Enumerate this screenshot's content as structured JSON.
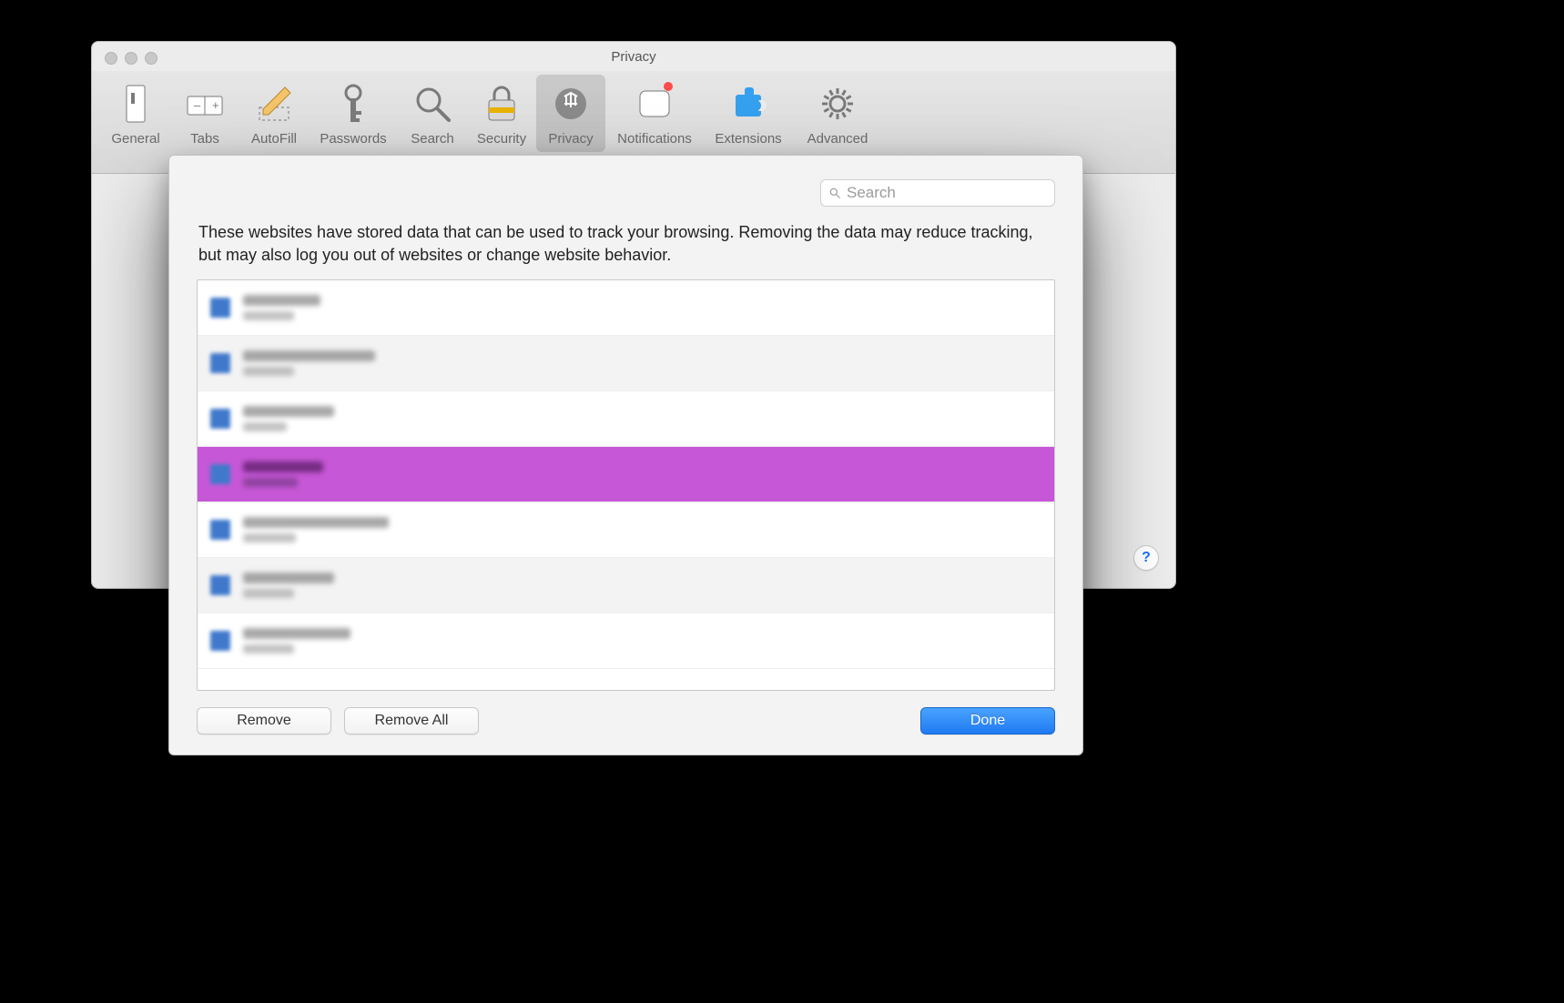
{
  "window": {
    "title": "Privacy"
  },
  "toolbar": {
    "items": [
      {
        "id": "general",
        "label": "General"
      },
      {
        "id": "tabs",
        "label": "Tabs"
      },
      {
        "id": "autofill",
        "label": "AutoFill"
      },
      {
        "id": "passwords",
        "label": "Passwords"
      },
      {
        "id": "search",
        "label": "Search"
      },
      {
        "id": "security",
        "label": "Security"
      },
      {
        "id": "privacy",
        "label": "Privacy",
        "active": true
      },
      {
        "id": "notifications",
        "label": "Notifications",
        "badge": true
      },
      {
        "id": "extensions",
        "label": "Extensions"
      },
      {
        "id": "advanced",
        "label": "Advanced"
      }
    ]
  },
  "sheet": {
    "search_placeholder": "Search",
    "description": "These websites have stored data that can be used to track your browsing. Removing the data may reduce tracking, but may also log you out of websites or change website behavior.",
    "sites": [
      {
        "domain_w": 85,
        "sub_w": 56,
        "selected": false
      },
      {
        "domain_w": 145,
        "sub_w": 56,
        "selected": false
      },
      {
        "domain_w": 100,
        "sub_w": 48,
        "selected": false
      },
      {
        "domain_w": 88,
        "sub_w": 60,
        "selected": true
      },
      {
        "domain_w": 160,
        "sub_w": 58,
        "selected": false
      },
      {
        "domain_w": 100,
        "sub_w": 56,
        "selected": false
      },
      {
        "domain_w": 118,
        "sub_w": 56,
        "selected": false
      }
    ],
    "buttons": {
      "remove": "Remove",
      "remove_all": "Remove All",
      "done": "Done"
    }
  },
  "help_glyph": "?"
}
